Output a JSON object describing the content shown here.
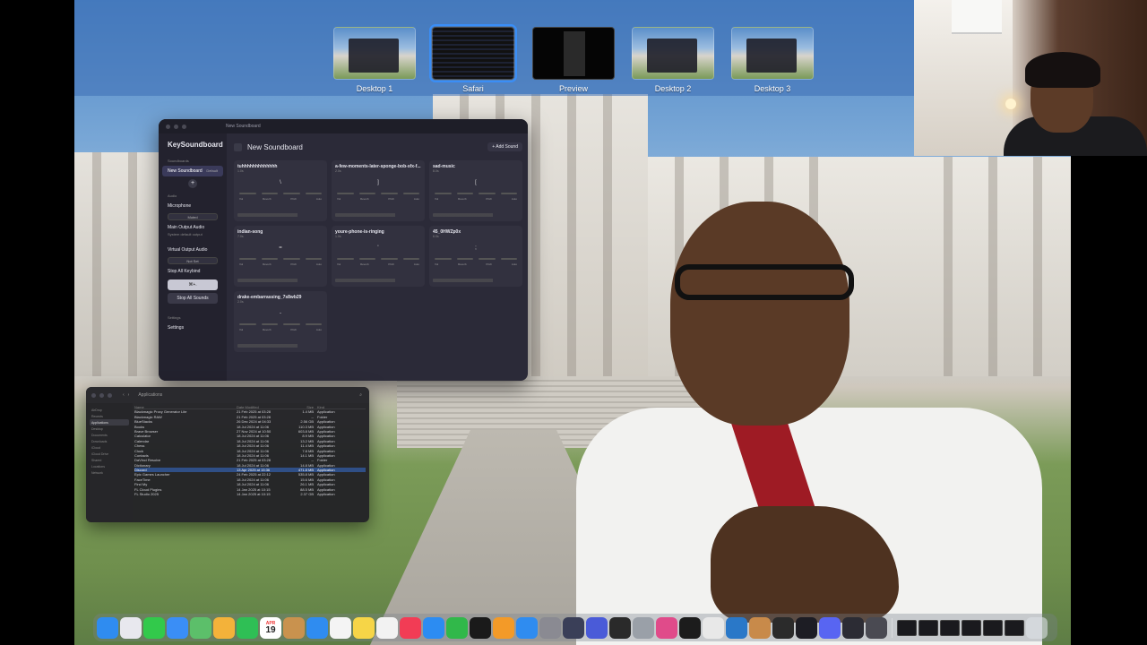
{
  "spaces": [
    {
      "label": "Desktop 1",
      "kind": "desk",
      "active": false
    },
    {
      "label": "Safari",
      "kind": "dark",
      "active": true
    },
    {
      "label": "Preview",
      "kind": "preview",
      "active": false
    },
    {
      "label": "Desktop 2",
      "kind": "desk",
      "active": false
    },
    {
      "label": "Desktop 3",
      "kind": "desk",
      "active": false
    }
  ],
  "keysoundboard": {
    "window_title": "New Soundboard",
    "app_name": "KeySoundboard",
    "sidebar": {
      "soundboards_heading": "Soundboards",
      "current_board": "New Soundboard",
      "current_board_badge": "Default",
      "audio_heading": "Audio",
      "microphone_label": "Microphone",
      "microphone_value": "Muted",
      "main_output_label": "Main Output Audio",
      "main_output_value": "System default output",
      "virtual_output_label": "Virtual Output Audio",
      "virtual_output_value": "Not Set",
      "stop_all_keybind_label": "Stop All Keybind",
      "stop_all_keybind_value": "⌘+.",
      "stop_all_button": "Stop All Sounds",
      "settings_heading": "Settings",
      "settings_item": "Settings"
    },
    "main": {
      "title": "New Soundboard",
      "add_button": "+ Add Sound",
      "slider_labels": [
        "Vol",
        "Reverb",
        "Pitch",
        "Auto"
      ],
      "sounds": [
        {
          "name": "tuhhhhhhhhhhhhh",
          "duration": "1.0s",
          "key": "\\"
        },
        {
          "name": "a-few-moments-later-sponge-bob-sfx-f...",
          "duration": "2.0s",
          "key": "]"
        },
        {
          "name": "sad-music",
          "duration": "8.0s",
          "key": "["
        },
        {
          "name": "indian-song",
          "duration": "7.0s",
          "key": "="
        },
        {
          "name": "youre-phone-is-ringing",
          "duration": "1.0s",
          "key": "'"
        },
        {
          "name": "45_0HWZp0x",
          "duration": "6.0s",
          "key": ";"
        },
        {
          "name": "drake-embarrassing_7s8wb29",
          "duration": "2.0s",
          "key": "-"
        }
      ]
    }
  },
  "finder": {
    "title": "Applications",
    "sidebar": [
      "AirDrop",
      "Recents",
      "Applications",
      "Desktop",
      "Documents",
      "Downloads",
      "iCloud",
      "iCloud Drive",
      "Shared",
      "Locations",
      "Network"
    ],
    "columns": [
      "Name",
      "Date Modified",
      "Size",
      "Kind"
    ],
    "rows": [
      [
        "Blackmagic Proxy Generator Lite",
        "21 Feb 2025 at 03:28",
        "1.4 MB",
        "Application"
      ],
      [
        "Blackmagic RAW",
        "21 Feb 2025 at 03:28",
        "--",
        "Folder"
      ],
      [
        "BlueStacks",
        "26 Dec 2024 at 04:33",
        "2.56 GB",
        "Application"
      ],
      [
        "Books",
        "18 Jul 2024 at 11:06",
        "110.3 MB",
        "Application"
      ],
      [
        "Brave Browser",
        "27 Nov 2024 at 10:50",
        "603.8 MB",
        "Application"
      ],
      [
        "Calculator",
        "18 Jul 2024 at 11:06",
        "8.9 MB",
        "Application"
      ],
      [
        "Calendar",
        "18 Jul 2024 at 11:06",
        "13.2 MB",
        "Application"
      ],
      [
        "Chess",
        "18 Jul 2024 at 11:06",
        "11.4 MB",
        "Application"
      ],
      [
        "Clock",
        "18 Jul 2024 at 11:06",
        "7.8 MB",
        "Application"
      ],
      [
        "Contacts",
        "18 Jul 2024 at 11:06",
        "14.1 MB",
        "Application"
      ],
      [
        "DaVinci Resolve",
        "21 Feb 2025 at 03:28",
        "--",
        "Folder"
      ],
      [
        "Dictionary",
        "18 Jul 2024 at 11:06",
        "14.8 MB",
        "Application"
      ],
      [
        "Discord",
        "13 Apr 2025 at 15:36",
        "471.8 MB",
        "Application"
      ],
      [
        "Epic Games Launcher",
        "24 Feb 2025 at 22:12",
        "535.8 MB",
        "Application"
      ],
      [
        "FaceTime",
        "18 Jul 2024 at 11:06",
        "15.6 MB",
        "Application"
      ],
      [
        "Find My",
        "18 Jul 2024 at 11:06",
        "26.1 MB",
        "Application"
      ],
      [
        "FL Cloud Plugins",
        "14 Jan 2025 at 10:15",
        "88.5 MB",
        "Application"
      ],
      [
        "FL Studio 2025",
        "14 Jan 2025 at 10:15",
        "2.37 GB",
        "Application"
      ]
    ],
    "selected_row": 12
  },
  "dock": {
    "calendar_month": "APR",
    "calendar_day": "19",
    "apps": [
      {
        "name": "finder-icon",
        "color": "#2f8cf0"
      },
      {
        "name": "launchpad-icon",
        "color": "#e8e8ee"
      },
      {
        "name": "messages-icon",
        "color": "#32c94b"
      },
      {
        "name": "mail-icon",
        "color": "#3a8ef6"
      },
      {
        "name": "maps-icon",
        "color": "#5cbf6a"
      },
      {
        "name": "photos-icon",
        "color": "#f3b23a"
      },
      {
        "name": "facetime-icon",
        "color": "#2fbf55"
      },
      {
        "name": "calendar-icon",
        "color": "#ffffff"
      },
      {
        "name": "reminders-box-icon",
        "color": "#c9924e"
      },
      {
        "name": "safari-icon",
        "color": "#2f8cf0"
      },
      {
        "name": "reminders-icon",
        "color": "#f4f4f4"
      },
      {
        "name": "notes-icon",
        "color": "#f6d547"
      },
      {
        "name": "freeform-icon",
        "color": "#f2f2f2"
      },
      {
        "name": "music-icon",
        "color": "#f23c55"
      },
      {
        "name": "keynote-icon",
        "color": "#2c8cf2"
      },
      {
        "name": "numbers-icon",
        "color": "#31b84a"
      },
      {
        "name": "appletv-icon",
        "color": "#1a1a1a"
      },
      {
        "name": "pages-icon",
        "color": "#f39a28"
      },
      {
        "name": "appstore-icon",
        "color": "#2f8cf0"
      },
      {
        "name": "system-settings-icon",
        "color": "#8a8a92"
      },
      {
        "name": "davinci-icon",
        "color": "#3a3f58"
      },
      {
        "name": "screens-icon",
        "color": "#4a5bd8"
      },
      {
        "name": "unity-icon",
        "color": "#2a2a2a"
      },
      {
        "name": "help-icon",
        "color": "#9aa0a8"
      },
      {
        "name": "robot-icon",
        "color": "#e04b8a"
      },
      {
        "name": "terminal-icon",
        "color": "#1c1c1c"
      },
      {
        "name": "chrome-icon",
        "color": "#e8e8e8"
      },
      {
        "name": "vscode-icon",
        "color": "#2a78c8"
      },
      {
        "name": "preview-icon",
        "color": "#c88a4a"
      },
      {
        "name": "console-icon",
        "color": "#2b2b2b"
      },
      {
        "name": "audio-icon",
        "color": "#1d1d24"
      },
      {
        "name": "discord-icon",
        "color": "#5865f2"
      },
      {
        "name": "obs-icon",
        "color": "#2c2c34"
      },
      {
        "name": "simulator-icon",
        "color": "#4a4a52"
      }
    ],
    "minimized_count": 6,
    "trash": "trash-icon"
  }
}
